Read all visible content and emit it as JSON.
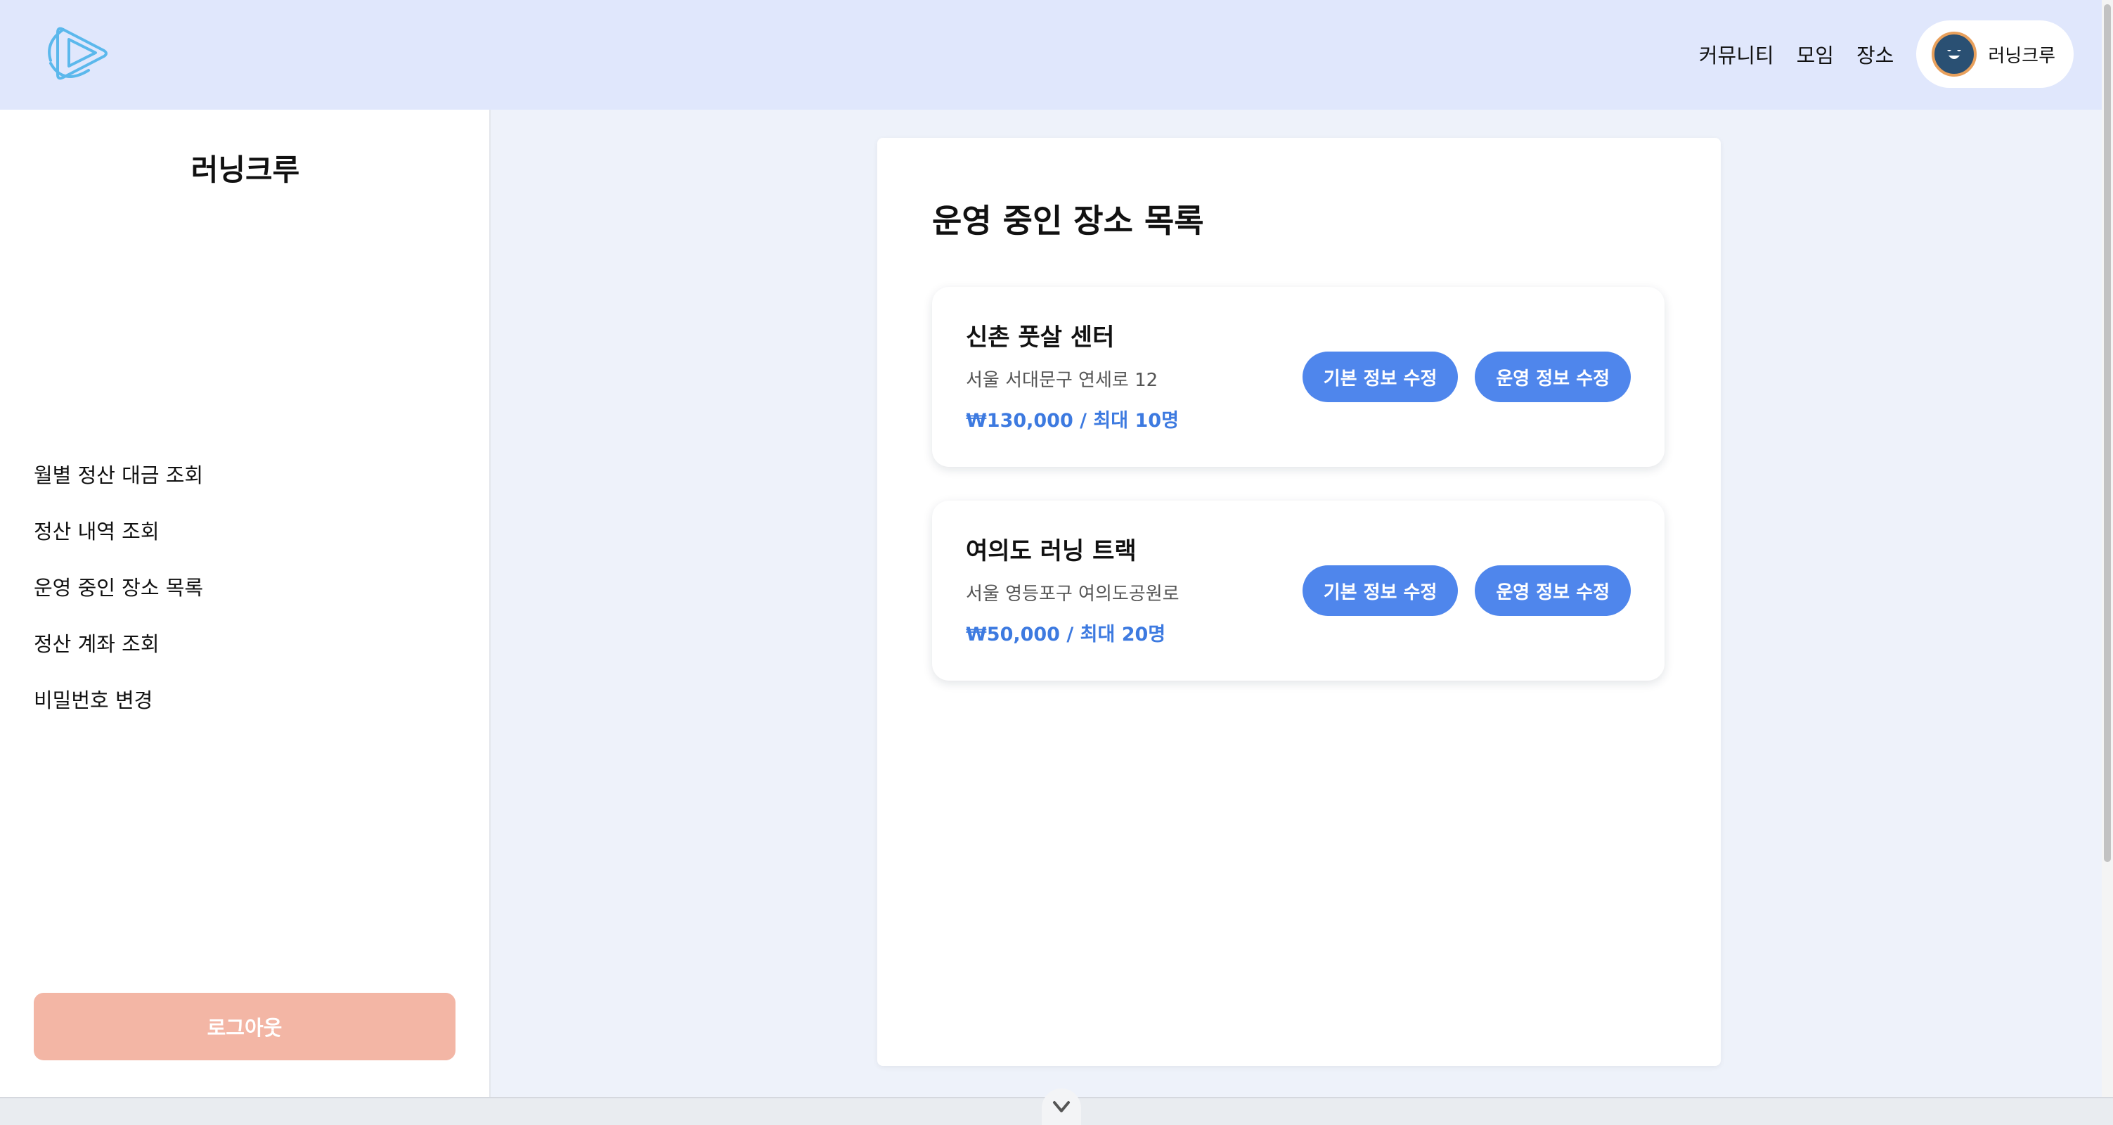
{
  "header": {
    "logo_icon": "play-logo-icon",
    "nav": [
      {
        "label": "커뮤니티"
      },
      {
        "label": "모임"
      },
      {
        "label": "장소"
      }
    ],
    "profile": {
      "avatar_icon": "avatar-icon",
      "name": "러닝크루"
    }
  },
  "sidebar": {
    "title": "러닝크루",
    "menu": [
      {
        "label": "월별 정산 대금 조회"
      },
      {
        "label": "정산 내역 조회"
      },
      {
        "label": "운영 중인 장소 목록"
      },
      {
        "label": "정산 계좌 조회"
      },
      {
        "label": "비밀번호 변경"
      }
    ],
    "logout_label": "로그아웃"
  },
  "main": {
    "title": "운영 중인 장소 목록",
    "venues": [
      {
        "name": "신촌 풋살 센터",
        "address": "서울 서대문구 연세로 12",
        "price": "₩130,000 / 최대 10명",
        "edit_basic_label": "기본 정보 수정",
        "edit_operation_label": "운영 정보 수정"
      },
      {
        "name": "여의도 러닝 트랙",
        "address": "서울 영등포구 여의도공원로",
        "price": "₩50,000 / 최대 20명",
        "edit_basic_label": "기본 정보 수정",
        "edit_operation_label": "운영 정보 수정"
      }
    ]
  },
  "colors": {
    "header_bg": "#e0e7fc",
    "page_bg": "#eef2fa",
    "accent_button": "#4f86ec",
    "price_text": "#3d7ae0",
    "logout_bg": "#f3b6a5",
    "logo_stroke": "#5bb8ec"
  },
  "bottom_bar": {
    "handle_icon": "chevron-down-icon"
  }
}
